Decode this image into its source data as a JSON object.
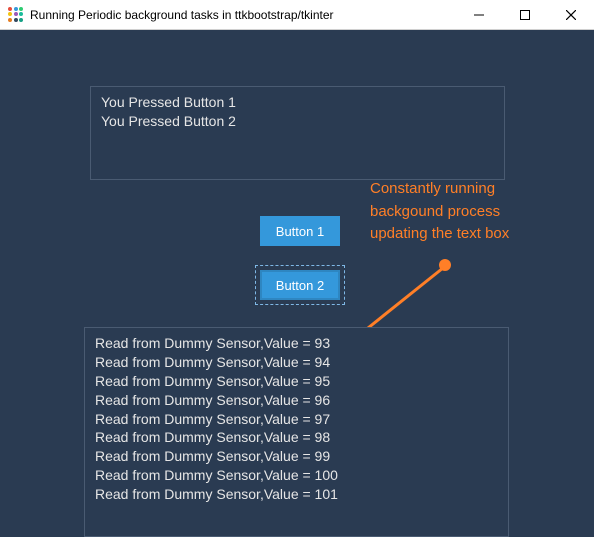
{
  "window": {
    "title": "Running Periodic background tasks in ttkbootstrap/tkinter"
  },
  "topTextbox": {
    "lines": [
      "You Pressed Button 1",
      "You Pressed Button 2"
    ]
  },
  "buttons": {
    "button1": "Button 1",
    "button2": "Button 2"
  },
  "annotation": {
    "line1": "Constantly running",
    "line2": "backgound process",
    "line3": "updating the text box"
  },
  "bottomTextbox": {
    "lines": [
      "Read from Dummy Sensor,Value = 93",
      "Read from Dummy Sensor,Value = 94",
      "Read from Dummy Sensor,Value = 95",
      "Read from Dummy Sensor,Value = 96",
      "Read from Dummy Sensor,Value = 97",
      "Read from Dummy Sensor,Value = 98",
      "Read from Dummy Sensor,Value = 99",
      "Read from Dummy Sensor,Value = 100",
      "Read from Dummy Sensor,Value = 101"
    ]
  }
}
